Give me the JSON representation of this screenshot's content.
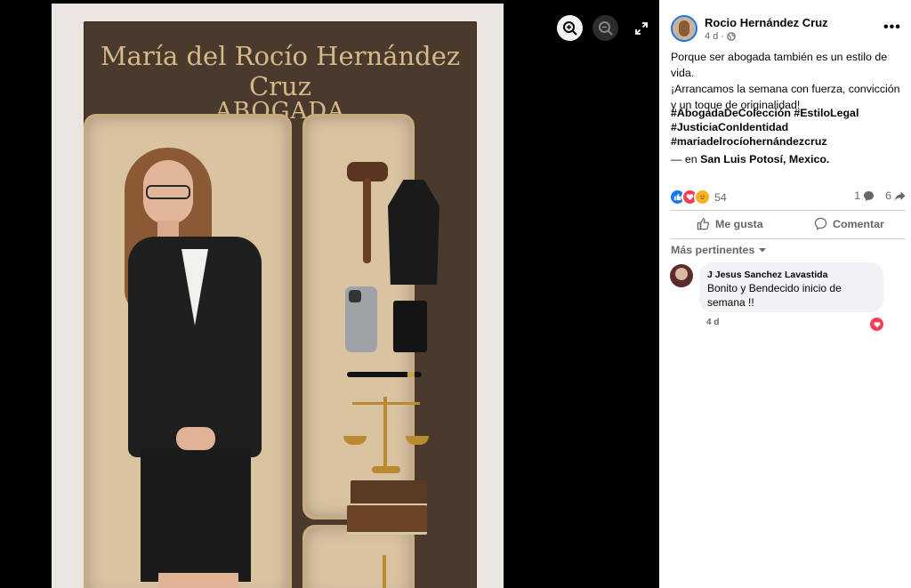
{
  "photo": {
    "title_line1": "María del Rocío Hernández",
    "title_line2": "Cruz",
    "title_line3": "ABOGADA"
  },
  "viewer": {
    "controls": [
      "zoom-in-icon",
      "zoom-out-icon",
      "fullscreen-icon"
    ]
  },
  "post": {
    "author": "Rocio Hernández Cruz",
    "time": "4 d",
    "privacy_icon": "globe-icon",
    "more_label": "•••",
    "text_line1": "Porque ser abogada también es un estilo de vida.",
    "text_line2": "¡Arrancamos la semana con fuerza, convicción y un toque de originalidad!",
    "hashtag1": "#AbogadaDeColección",
    "hashtag2": "#EstiloLegal",
    "hashtag3": "#JusticiaConIdentidad",
    "hashtag4": "#mariadelrocíohernándezcruz",
    "location_prefix": "— en",
    "location": "San Luis Potosí, Mexico."
  },
  "engagement": {
    "reaction_count": "54",
    "comment_count": "1",
    "share_count": "6",
    "like_label": "Me gusta",
    "comment_label": "Comentar",
    "colors": {
      "like": "#1877f2",
      "love": "#f33e58",
      "care": "#f7b125"
    }
  },
  "comments": {
    "sort_label": "Más pertinentes",
    "items": [
      {
        "name": "J Jesus Sanchez Lavastida",
        "text": "Bonito y Bendecido inicio de semana !!",
        "time": "4 d",
        "reaction": "love"
      }
    ]
  }
}
